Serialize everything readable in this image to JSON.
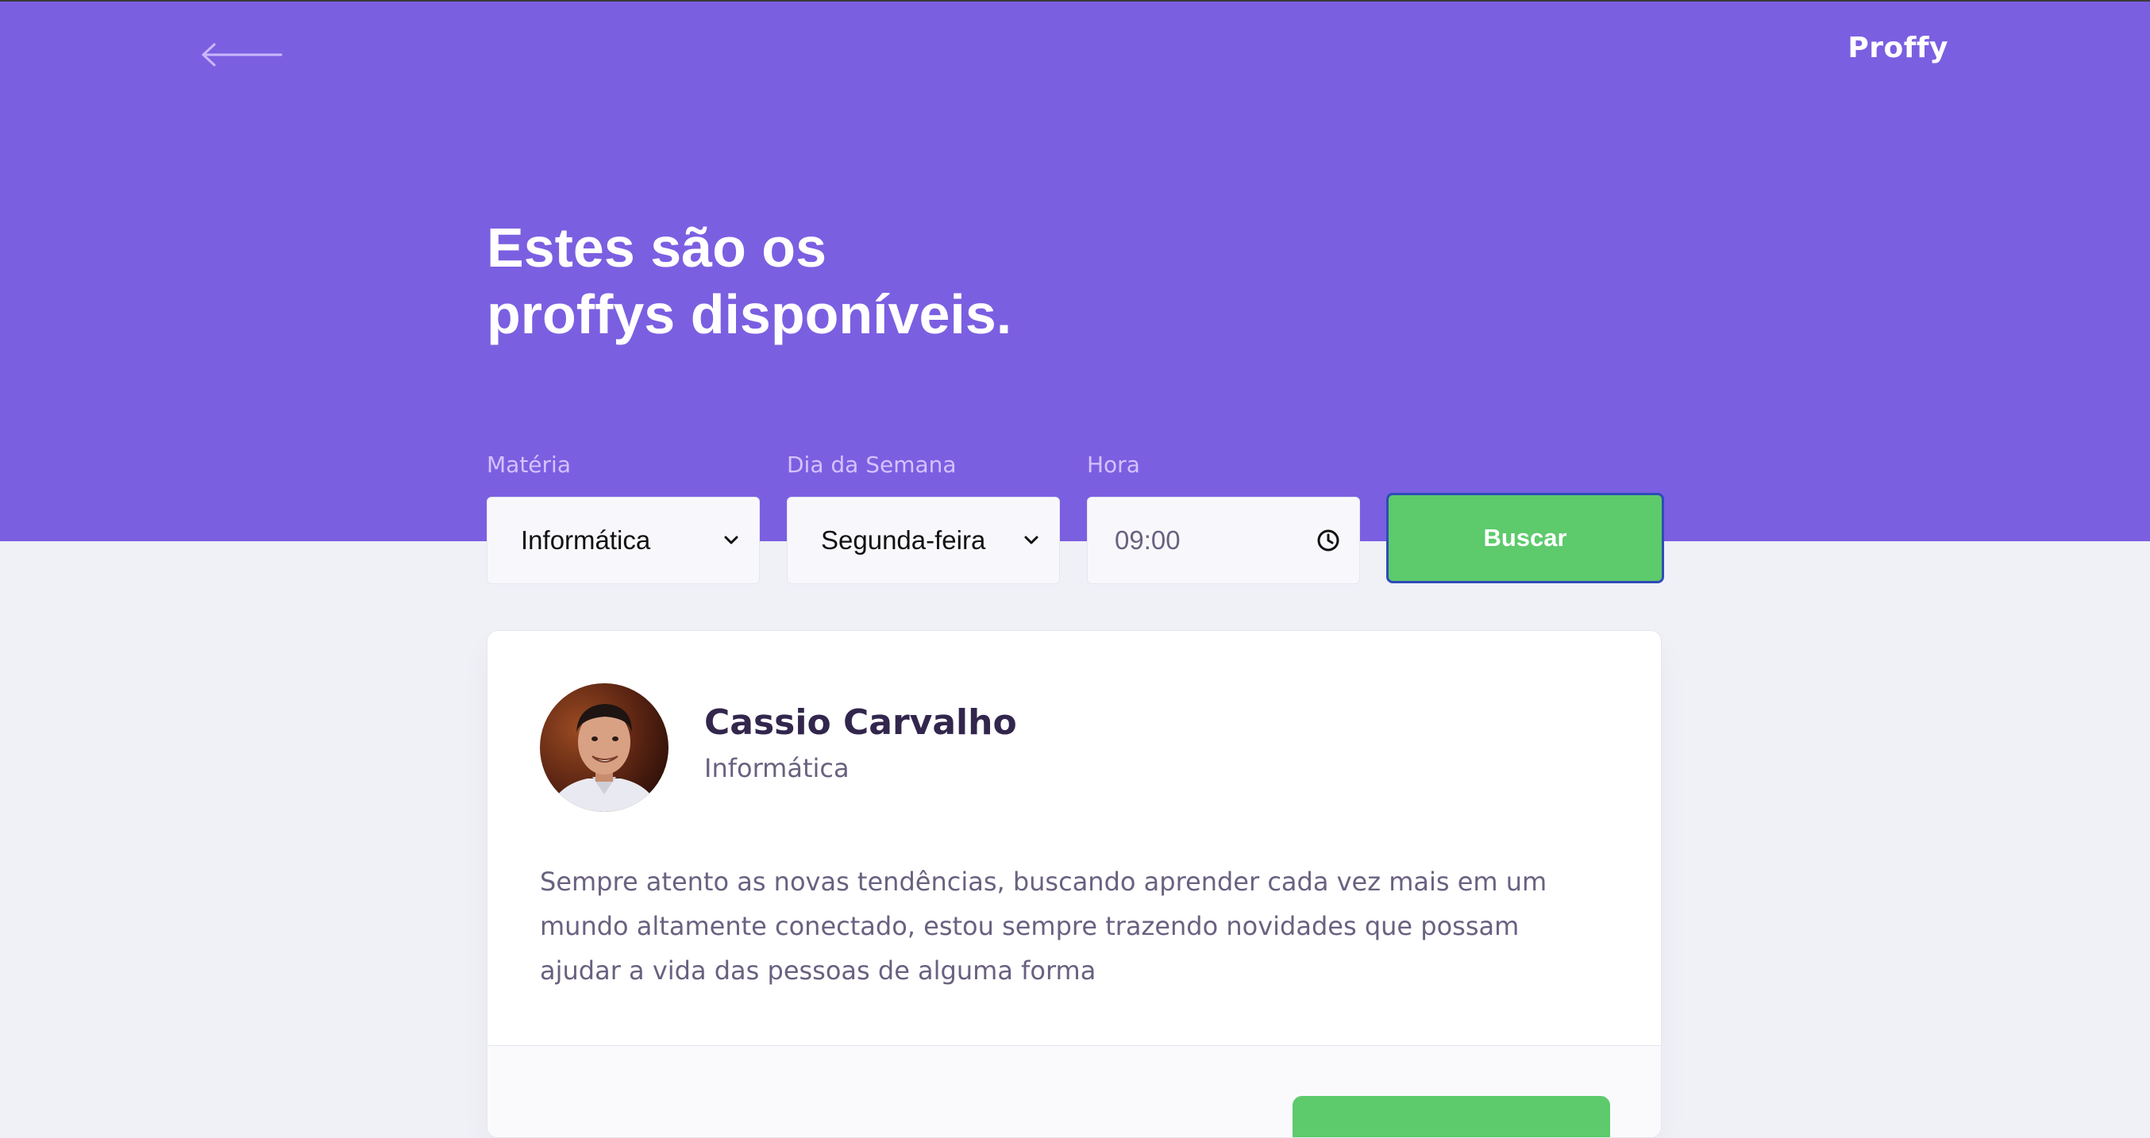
{
  "app": {
    "logo": "Proffy"
  },
  "header": {
    "back_icon": "arrow-left-icon",
    "title_line1": "Estes são os",
    "title_line2": "proffys disponíveis."
  },
  "filters": {
    "subject": {
      "label": "Matéria",
      "value": "Informática",
      "icon": "chevron-down-icon"
    },
    "week_day": {
      "label": "Dia da Semana",
      "value": "Segunda-feira",
      "icon": "chevron-down-icon"
    },
    "time": {
      "label": "Hora",
      "value": "09:00",
      "icon": "clock-icon"
    },
    "search_button": "Buscar"
  },
  "teacher": {
    "name": "Cassio Carvalho",
    "subject": "Informática",
    "bio": "Sempre atento as novas tendências, buscando aprender cada vez mais em um mundo altamente conectado, estou sempre trazendo novidades que possam ajudar a vida das pessoas de alguma forma"
  },
  "colors": {
    "primary": "#7B5FE1",
    "secondary": "#5DCA6C",
    "background": "#F0F0F7",
    "title_text": "#32264D",
    "body_text": "#6A6180",
    "label_text": "#D4C2FF"
  }
}
